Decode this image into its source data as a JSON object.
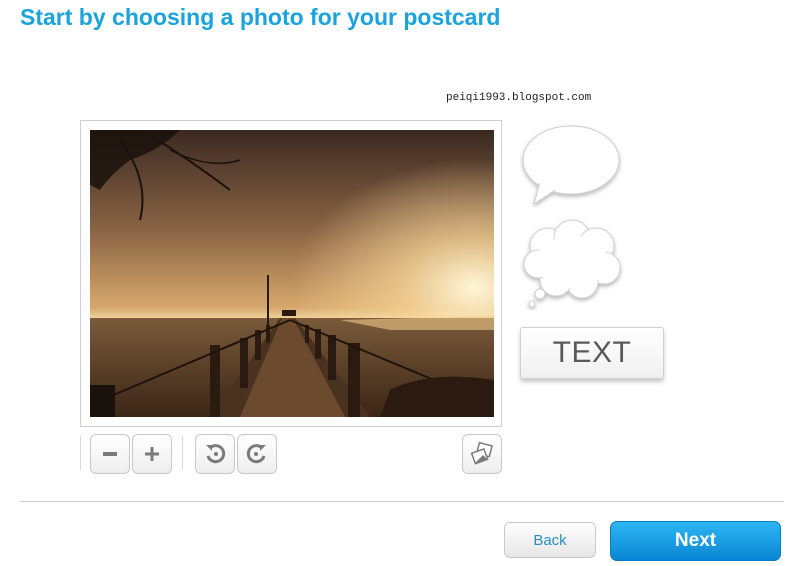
{
  "page": {
    "title": "Start by choosing a photo for your postcard",
    "watermark": "peiqi1993.blogspot.com"
  },
  "colors": {
    "title": "#1aa3dd",
    "next_button": "#1a9fe4",
    "back_text": "#2a8fc8"
  },
  "photo": {
    "description_icon": "sunset-pier-photo"
  },
  "toolbar": {
    "zoom_out_icon": "minus-icon",
    "zoom_in_icon": "plus-icon",
    "rotate_left_icon": "rotate-left-icon",
    "rotate_right_icon": "rotate-right-icon",
    "replace_icon": "photo-swap-icon"
  },
  "stickers": {
    "speech_icon": "speech-bubble-icon",
    "thought_icon": "thought-bubble-icon",
    "text_label": "TEXT"
  },
  "footer": {
    "back_label": "Back",
    "next_label": "Next"
  }
}
